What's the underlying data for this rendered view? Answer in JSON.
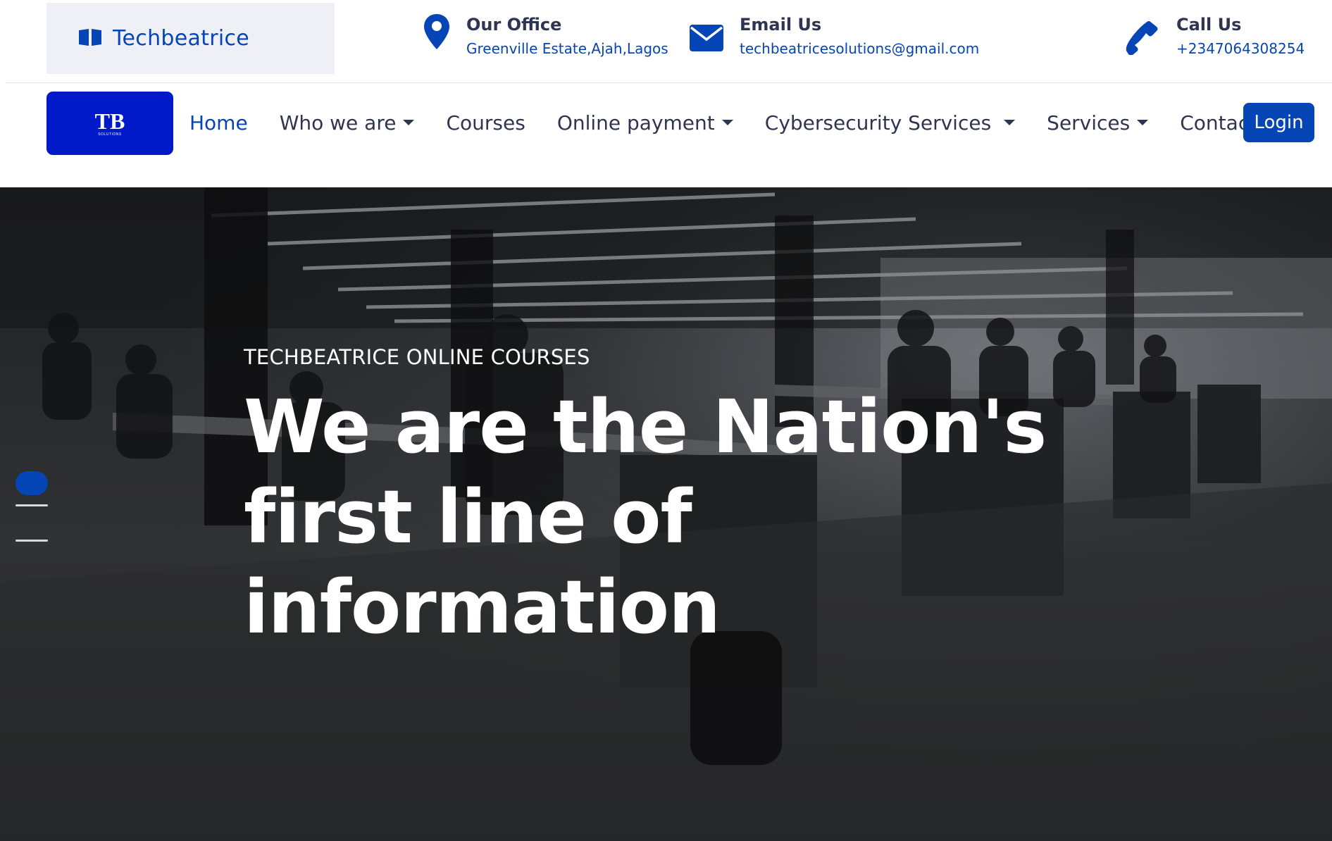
{
  "brand": {
    "name": "Techbeatrice",
    "icon": "book-icon"
  },
  "contact_info": [
    {
      "icon": "map-pin-icon",
      "title": "Our Office",
      "value": "Greenville Estate,Ajah,Lagos"
    },
    {
      "icon": "envelope-icon",
      "title": "Email Us",
      "value": "techbeatricesolutions@gmail.com"
    },
    {
      "icon": "phone-icon",
      "title": "Call Us",
      "value": "+2347064308254"
    }
  ],
  "nav": {
    "logo_text": "TB",
    "logo_subtext": "SOLUTIONS",
    "items": [
      {
        "label": "Home",
        "active": true,
        "dropdown": false
      },
      {
        "label": "Who we are",
        "active": false,
        "dropdown": true
      },
      {
        "label": "Courses",
        "active": false,
        "dropdown": false
      },
      {
        "label": "Online payment",
        "active": false,
        "dropdown": true
      },
      {
        "label": "Cybersecurity Services",
        "active": false,
        "dropdown": true
      },
      {
        "label": "Services",
        "active": false,
        "dropdown": true
      },
      {
        "label": "Contact",
        "active": false,
        "dropdown": false
      }
    ],
    "login_label": "Login"
  },
  "hero": {
    "eyebrow": "TECHBEATRICE ONLINE COURSES",
    "title_lines": [
      "We are the Nation's",
      "first line of",
      "information"
    ],
    "slides": {
      "count": 3,
      "active": 1
    }
  },
  "colors": {
    "accent": "#0645b5",
    "logo_bg": "#0019c9",
    "text": "#2f3550"
  }
}
